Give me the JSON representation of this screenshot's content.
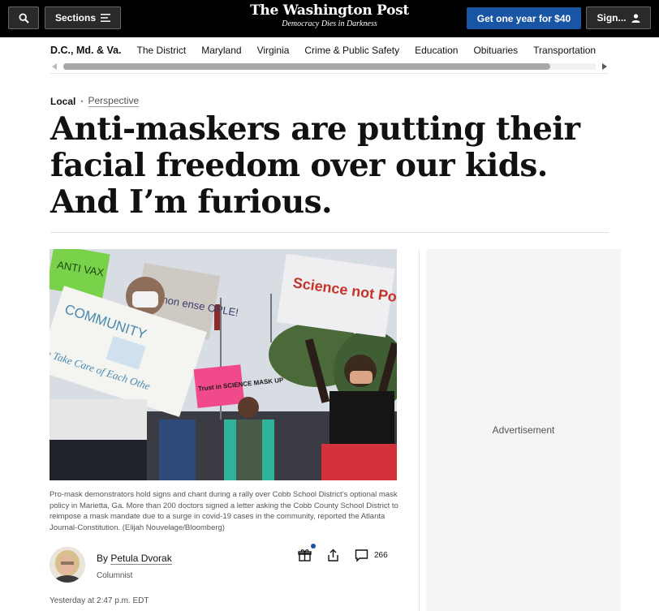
{
  "colors": {
    "topbar_bg": "#000000",
    "subscribe_bg": "#1955a5",
    "ad_bg": "#f4f4f4"
  },
  "header": {
    "search_icon": "search-icon",
    "sections_label": "Sections",
    "sections_icon": "menu-icon",
    "brand_title": "The Washington Post",
    "brand_tagline": "Democracy Dies in Darkness",
    "subscribe_label": "Get one year for $40",
    "signin_label": "Sign...",
    "signin_icon": "user-icon"
  },
  "subnav": {
    "section_label": "D.C., Md. & Va.",
    "links": [
      "The District",
      "Maryland",
      "Virginia",
      "Crime & Public Safety",
      "Education",
      "Obituaries",
      "Transportation"
    ]
  },
  "article": {
    "section": "Local",
    "label": "Perspective",
    "headline": "Anti-maskers are putting their facial freedom over our kids. And I’m furious.",
    "photo_signs": {
      "sign_antivax": "ANTI VAX",
      "sign_common_sense": "mmon ense OPLE!",
      "sign_community": "COMMUNITY",
      "sign_take_care": "e Take Care of Each Othe",
      "sign_science": "Science not Politics",
      "sign_trust": "Trust in SCIENCE MASK UP"
    },
    "caption": "Pro-mask demonstrators hold signs and chant during a rally over Cobb School District’s optional mask policy in Marietta, Ga. More than 200 doctors signed a letter asking the Cobb County School District to reimpose a mask mandate due to a surge in covid-19 cases in the community, reported the Atlanta Journal-Constitution. (Elijah Nouvelage/Bloomberg)",
    "byline_prefix": "By",
    "author": "Petula Dvorak",
    "role": "Columnist",
    "comment_count": "266",
    "timestamp": "Yesterday at 2:47 p.m. EDT"
  },
  "ad": {
    "label": "Advertisement"
  }
}
